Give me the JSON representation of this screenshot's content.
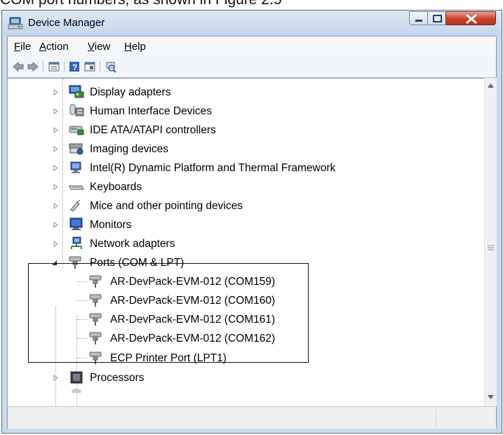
{
  "document": {
    "caption": "COM port numbers, as shown in Figure 2.5"
  },
  "window": {
    "title": "Device Manager"
  },
  "menubar": {
    "items": [
      {
        "accel": "F",
        "rest": "ile"
      },
      {
        "accel": "A",
        "rest": "ction"
      },
      {
        "accel": "V",
        "rest": "iew"
      },
      {
        "accel": "H",
        "rest": "elp"
      }
    ]
  },
  "tree": {
    "categories": [
      {
        "label": "Display adapters",
        "icon": "display-adapter-icon",
        "expanded": false
      },
      {
        "label": "Human Interface Devices",
        "icon": "hid-icon",
        "expanded": false
      },
      {
        "label": "IDE ATA/ATAPI controllers",
        "icon": "ide-controller-icon",
        "expanded": false
      },
      {
        "label": "Imaging devices",
        "icon": "imaging-device-icon",
        "expanded": false
      },
      {
        "label": "Intel(R) Dynamic Platform and Thermal Framework",
        "icon": "intel-framework-icon",
        "expanded": false
      },
      {
        "label": "Keyboards",
        "icon": "keyboard-icon",
        "expanded": false
      },
      {
        "label": "Mice and other pointing devices",
        "icon": "mouse-icon",
        "expanded": false
      },
      {
        "label": "Monitors",
        "icon": "monitor-icon",
        "expanded": false
      },
      {
        "label": "Network adapters",
        "icon": "network-adapter-icon",
        "expanded": false
      },
      {
        "label": "Ports (COM & LPT)",
        "icon": "port-icon",
        "expanded": true
      },
      {
        "label": "Processors",
        "icon": "processor-icon",
        "expanded": false
      }
    ],
    "ports": [
      {
        "label": "AR-DevPack-EVM-012 (COM159)"
      },
      {
        "label": "AR-DevPack-EVM-012 (COM160)"
      },
      {
        "label": "AR-DevPack-EVM-012 (COM161)"
      },
      {
        "label": "AR-DevPack-EVM-012 (COM162)"
      },
      {
        "label": "ECP Printer Port (LPT1)"
      }
    ]
  },
  "colors": {
    "highlight_box": "#111111",
    "close_button": "#c7432a"
  }
}
